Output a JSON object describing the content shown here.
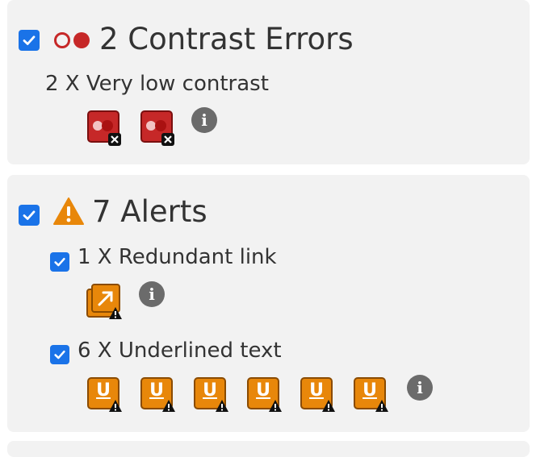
{
  "contrast": {
    "count": "2",
    "title": "Contrast Errors",
    "heading": "2 Contrast Errors",
    "items": [
      {
        "label": "2 X Very low contrast",
        "count": 2
      }
    ]
  },
  "alerts": {
    "heading": "7 Alerts",
    "items": [
      {
        "label": "1 X Redundant link",
        "count": 1
      },
      {
        "label": "6 X Underlined text",
        "count": 6
      }
    ]
  },
  "icons": {
    "info": "i",
    "underline_letter": "U"
  },
  "colors": {
    "checkbox": "#1a73e8",
    "error_red": "#c62828",
    "alert_orange": "#e8870a",
    "panel_bg": "#f2f2f2"
  }
}
